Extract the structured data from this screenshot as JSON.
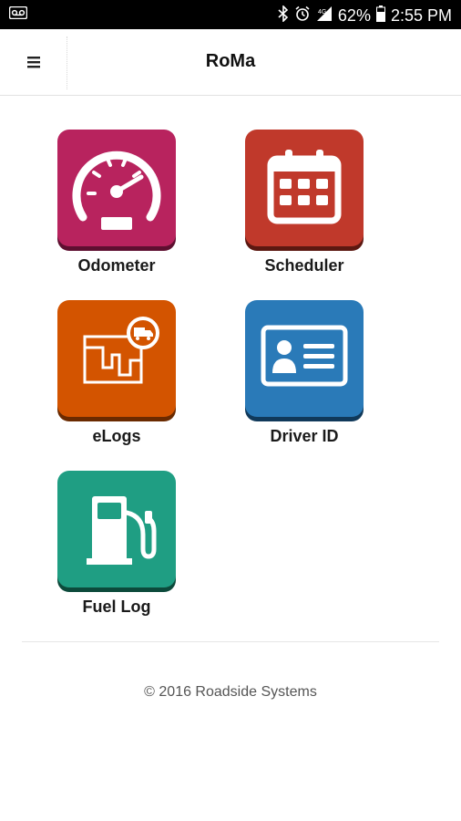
{
  "status_bar": {
    "battery_percent": "62%",
    "time": "2:55 PM",
    "icons": [
      "voicemail-icon",
      "bluetooth-icon",
      "alarm-icon",
      "signal-icon",
      "battery-icon"
    ]
  },
  "app_bar": {
    "title": "RoMa",
    "menu_icon": "menu-icon"
  },
  "tiles": [
    {
      "label": "Odometer",
      "color": "#b8235e",
      "icon": "speedometer-icon"
    },
    {
      "label": "Scheduler",
      "color": "#c0392b",
      "icon": "calendar-icon"
    },
    {
      "label": "eLogs",
      "color": "#d35400",
      "icon": "map-truck-icon"
    },
    {
      "label": "Driver ID",
      "color": "#2a7ab8",
      "icon": "id-card-icon"
    },
    {
      "label": "Fuel Log",
      "color": "#1f9e83",
      "icon": "fuel-pump-icon"
    }
  ],
  "footer": {
    "text": "© 2016 Roadside Systems"
  }
}
